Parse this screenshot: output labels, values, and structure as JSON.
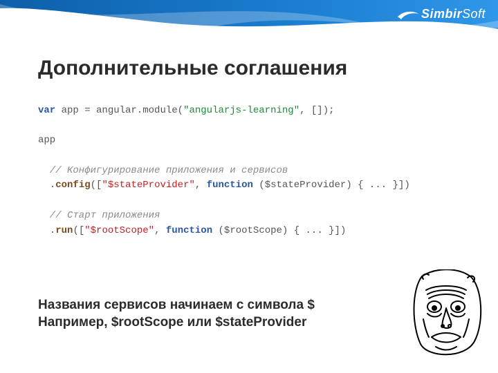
{
  "brand": {
    "name_bold": "Simbir",
    "name_light": "Soft"
  },
  "title": "Дополнительные соглашения",
  "code": {
    "l1a": "var",
    "l1b": " app = angular.module(",
    "l1c": "\"angularjs-learning\"",
    "l1d": ", []);",
    "l2": "app",
    "l3": "  // Конфигурирование приложения и сервисов",
    "l4a": "  .",
    "l4b": "config",
    "l4c": "([",
    "l4d": "\"$stateProvider\"",
    "l4e": ", ",
    "l4f": "function",
    "l4g": " ($stateProvider) { ... }])",
    "l5": "  // Старт приложения",
    "l6a": "  .",
    "l6b": "run",
    "l6c": "([",
    "l6d": "\"$rootScope\"",
    "l6e": ", ",
    "l6f": "function",
    "l6g": " ($rootScope) { ... }])"
  },
  "caption": {
    "line1": "Названия сервисов начинаем с символа $",
    "line2": "Например, $rootScope или $stateProvider"
  }
}
